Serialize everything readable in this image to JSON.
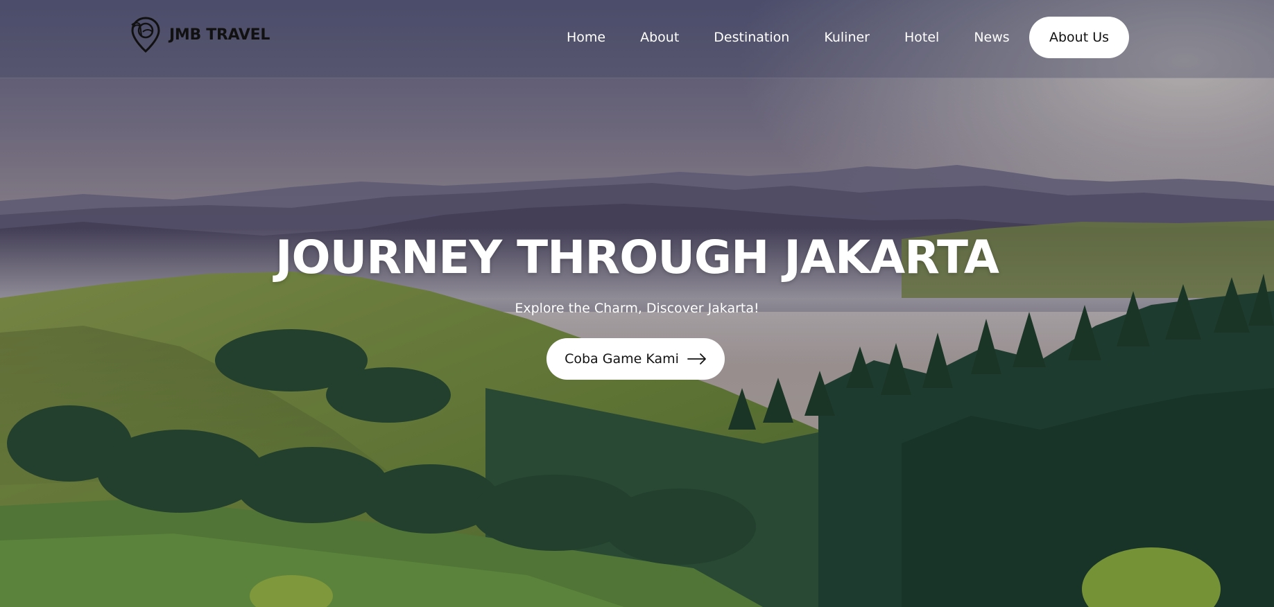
{
  "brand": {
    "name": "JMB TRAVEL",
    "logo_icon": "map-pin-palm-icon"
  },
  "nav": {
    "items": [
      "Home",
      "About",
      "Destination",
      "Kuliner",
      "Hotel",
      "News"
    ],
    "cta_label": "About Us"
  },
  "hero": {
    "title": "JOURNEY THROUGH JAKARTA",
    "subtitle": "Explore the Charm, Discover Jakarta!",
    "cta_label": "Coba Game Kami",
    "cta_icon": "arrow-right-icon",
    "background": "mountain-valley-landscape"
  },
  "colors": {
    "button_bg": "#ffffff",
    "button_text": "#111111",
    "nav_text": "#ffffff"
  }
}
